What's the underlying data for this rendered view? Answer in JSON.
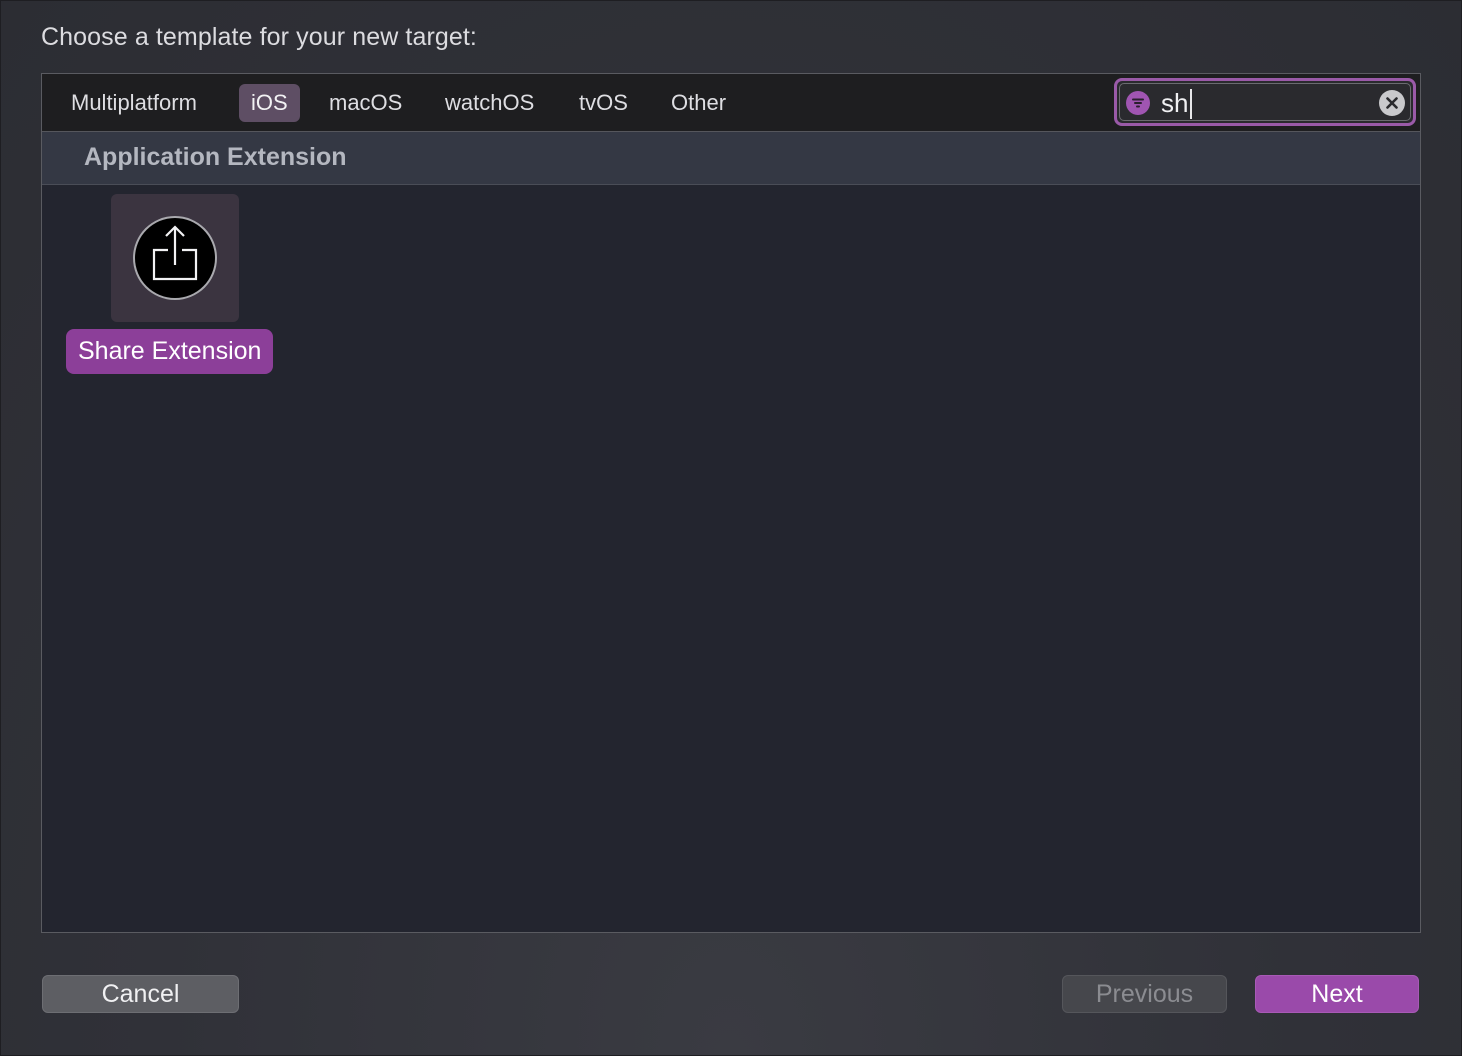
{
  "dialog": {
    "prompt": "Choose a template for your new target:"
  },
  "platform_tabs": [
    {
      "label": "Multiplatform",
      "selected": false
    },
    {
      "label": "iOS",
      "selected": true
    },
    {
      "label": "macOS",
      "selected": false
    },
    {
      "label": "watchOS",
      "selected": false
    },
    {
      "label": "tvOS",
      "selected": false
    },
    {
      "label": "Other",
      "selected": false
    }
  ],
  "search": {
    "value": "sh",
    "filter_icon": "filter-icon",
    "clear_icon": "clear-icon"
  },
  "section": {
    "title": "Application Extension"
  },
  "templates": [
    {
      "label": "Share Extension",
      "icon": "share-icon",
      "selected": true
    }
  ],
  "buttons": {
    "cancel": "Cancel",
    "previous": "Previous",
    "next": "Next"
  },
  "colors": {
    "accent": "#9a4aaa",
    "selected_tab": "#5e4e64",
    "section_header": "#343844"
  }
}
